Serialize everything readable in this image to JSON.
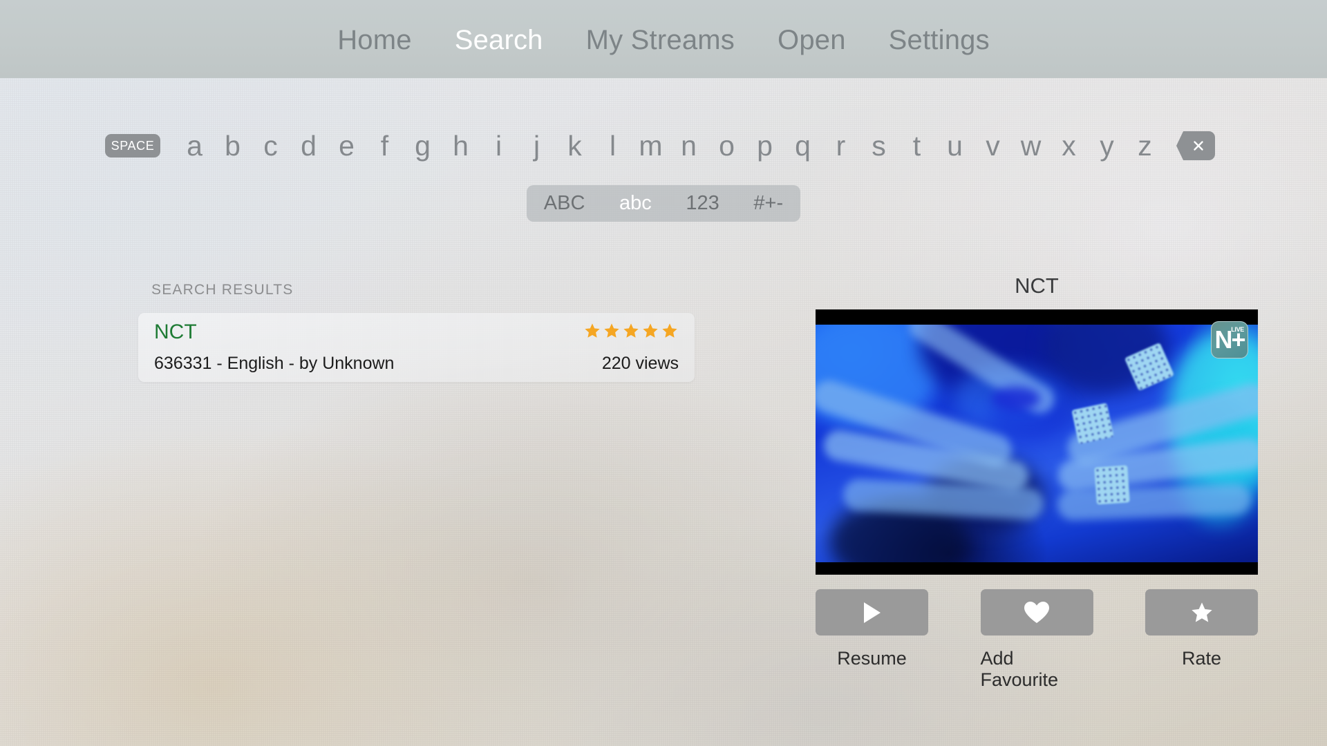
{
  "nav": {
    "items": [
      {
        "label": "Home",
        "active": false
      },
      {
        "label": "Search",
        "active": true
      },
      {
        "label": "My Streams",
        "active": false
      },
      {
        "label": "Open",
        "active": false
      },
      {
        "label": "Settings",
        "active": false
      }
    ]
  },
  "keyboard": {
    "space_label": "SPACE",
    "letters": [
      "a",
      "b",
      "c",
      "d",
      "e",
      "f",
      "g",
      "h",
      "i",
      "j",
      "k",
      "l",
      "m",
      "n",
      "o",
      "p",
      "q",
      "r",
      "s",
      "t",
      "u",
      "v",
      "w",
      "x",
      "y",
      "z"
    ],
    "delete_icon": "backspace-icon"
  },
  "mode_selector": {
    "options": [
      {
        "label": "ABC",
        "active": false
      },
      {
        "label": "abc",
        "active": true
      },
      {
        "label": "123",
        "active": false
      },
      {
        "label": "#+-",
        "active": false
      }
    ]
  },
  "results": {
    "section_label": "SEARCH RESULTS",
    "items": [
      {
        "title": "NCT",
        "meta": "636331 - English - by Unknown",
        "views": "220 views",
        "rating": 5,
        "max_rating": 5
      }
    ]
  },
  "preview": {
    "title": "NCT",
    "badge": {
      "text": "N+",
      "live_text": "LIVE"
    },
    "actions": [
      {
        "label": "Resume",
        "icon": "play-icon"
      },
      {
        "label": "Add Favourite",
        "icon": "heart-icon"
      },
      {
        "label": "Rate",
        "icon": "star-icon"
      }
    ]
  },
  "colors": {
    "nav_bg": "#c3caca",
    "nav_active": "#ffffff",
    "nav_inactive": "#7d8487",
    "result_title": "#1e7b34",
    "star": "#f5a623",
    "key_bg": "#8e9194",
    "action_bg": "#9a9a9a",
    "badge_bg": "#5d9a9c"
  }
}
